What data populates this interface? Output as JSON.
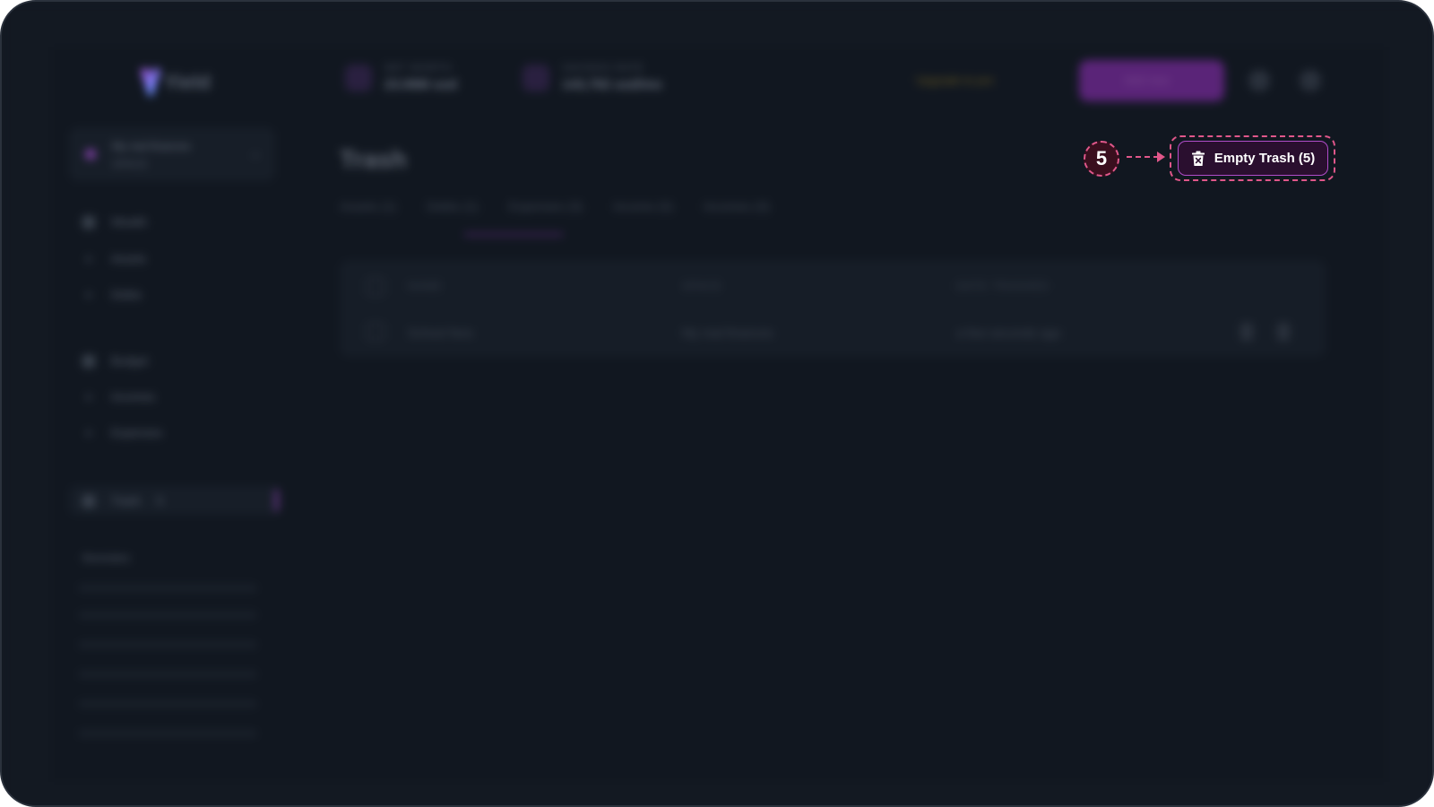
{
  "sidebar": {
    "logo": "Yield",
    "space": {
      "name": "My real finances",
      "sub": "SPACE"
    },
    "sections": [
      {
        "label": "Wealth",
        "items": [
          "Assets",
          "Debts"
        ]
      },
      {
        "label": "Budget",
        "items": [
          "Incomes",
          "Expenses"
        ]
      }
    ],
    "trash": {
      "label": "Trash",
      "count": "5"
    },
    "reminders_label": "Reminders"
  },
  "topbar": {
    "net_worth": {
      "label": "NET WORTH",
      "value": "23.99M usd"
    },
    "savings_rate": {
      "label": "SAVINGS RATE",
      "value": "143,792 usd/mo"
    },
    "upgrade": "Upgrade to pro",
    "add_new": "Add new"
  },
  "main": {
    "title": "Trash",
    "tabs": [
      "Assets (1)",
      "Debts (1)",
      "Expenses (3)",
      "Income (0)",
      "Incomes (0)"
    ],
    "table": {
      "headers": [
        "NAME",
        "SPACE",
        "DATE TRASHED"
      ],
      "rows": [
        {
          "name": "School fees",
          "space": "My real finances",
          "date": "a few seconds ago"
        }
      ]
    }
  },
  "callout": {
    "step": "5",
    "button_label": "Empty Trash (5)",
    "accent": "#e0578a",
    "button_border": "#b04cc8"
  }
}
